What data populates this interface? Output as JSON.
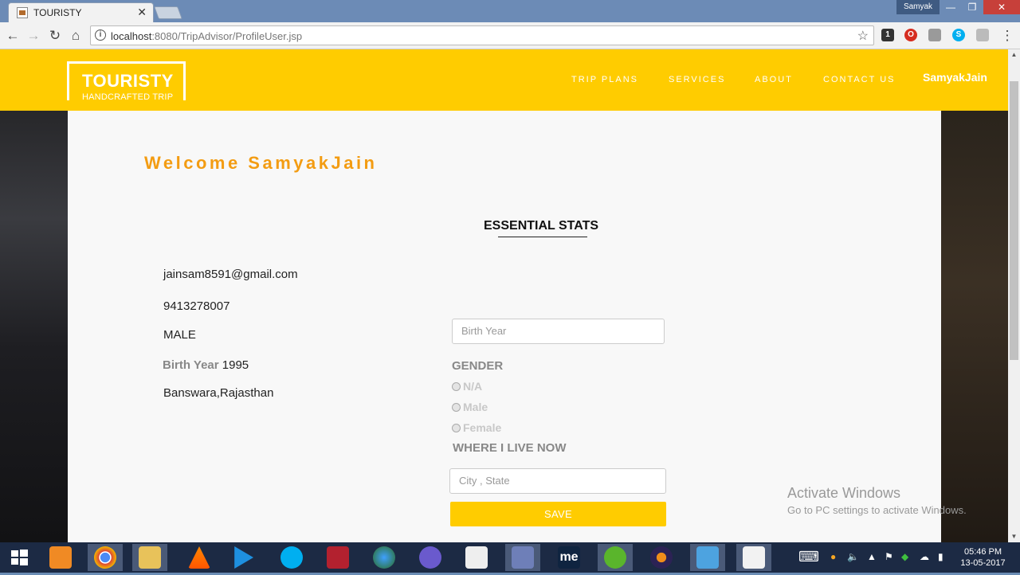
{
  "browser": {
    "tab_title": "TOURISTY",
    "tab_close": "✕",
    "profile_name": "Samyak",
    "url_host": "localhost",
    "url_rest": ":8080/TripAdvisor/ProfileUser.jsp",
    "ext_badge": "1"
  },
  "header": {
    "logo_name": "TOURISTY",
    "logo_tagline": "HANDCRAFTED TRIP",
    "nav": [
      "TRIP PLANS",
      "SERVICES",
      "ABOUT",
      "CONTACT US"
    ],
    "user": "SamyakJain"
  },
  "content": {
    "welcome": "Welcome SamyakJain",
    "stats_title": "ESSENTIAL STATS",
    "email": "jainsam8591@gmail.com",
    "phone": "9413278007",
    "gender_value": "MALE",
    "birth_year_label": "Birth Year",
    "birth_year_value": "1995",
    "location": "Banswara,Rajasthan"
  },
  "form": {
    "birth_year_placeholder": "Birth Year",
    "gender_label": "GENDER",
    "gender_options": [
      "N/A",
      "Male",
      "Female"
    ],
    "live_label": "WHERE I LIVE NOW",
    "city_placeholder": "City , State",
    "save_label": "SAVE"
  },
  "watermark": {
    "title": "Activate Windows",
    "subtitle": "Go to PC settings to activate Windows."
  },
  "taskbar": {
    "time": "05:46 PM",
    "date": "13-05-2017"
  },
  "colors": {
    "brand_yellow": "#ffcc00",
    "welcome_orange": "#f39c12"
  }
}
